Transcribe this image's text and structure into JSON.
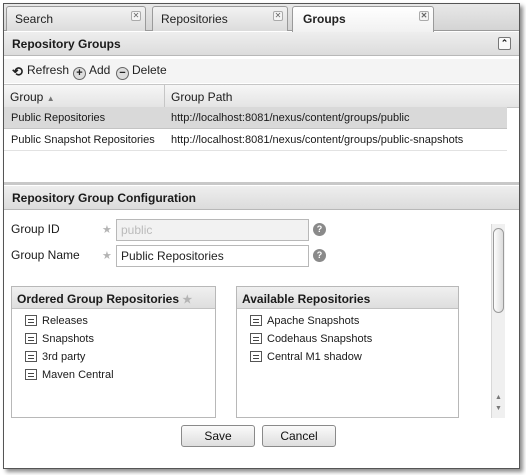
{
  "tabs": [
    {
      "label": "Search"
    },
    {
      "label": "Repositories"
    },
    {
      "label": "Groups"
    }
  ],
  "top_panel": {
    "title": "Repository Groups",
    "toolbar": {
      "refresh": "Refresh",
      "add": "Add",
      "delete": "Delete"
    },
    "columns": [
      "Group",
      "Group Path"
    ],
    "rows": [
      {
        "group": "Public Repositories",
        "path": "http://localhost:8081/nexus/content/groups/public",
        "selected": true
      },
      {
        "group": "Public Snapshot Repositories",
        "path": "http://localhost:8081/nexus/content/groups/public-snapshots",
        "selected": false
      }
    ]
  },
  "config_panel": {
    "title": "Repository Group Configuration",
    "group_id": {
      "label": "Group ID",
      "value": "public"
    },
    "group_name": {
      "label": "Group Name",
      "value": "Public Repositories"
    },
    "ordered": {
      "title": "Ordered Group Repositories",
      "items": [
        "Releases",
        "Snapshots",
        "3rd party",
        "Maven Central"
      ]
    },
    "available": {
      "title": "Available Repositories",
      "items": [
        "Apache Snapshots",
        "Codehaus Snapshots",
        "Central M1 shadow"
      ]
    },
    "save_label": "Save",
    "cancel_label": "Cancel"
  },
  "icons": {
    "refresh": "refresh-icon",
    "add": "add-icon",
    "delete": "delete-icon",
    "help": "help-icon",
    "repo": "repository-icon"
  }
}
